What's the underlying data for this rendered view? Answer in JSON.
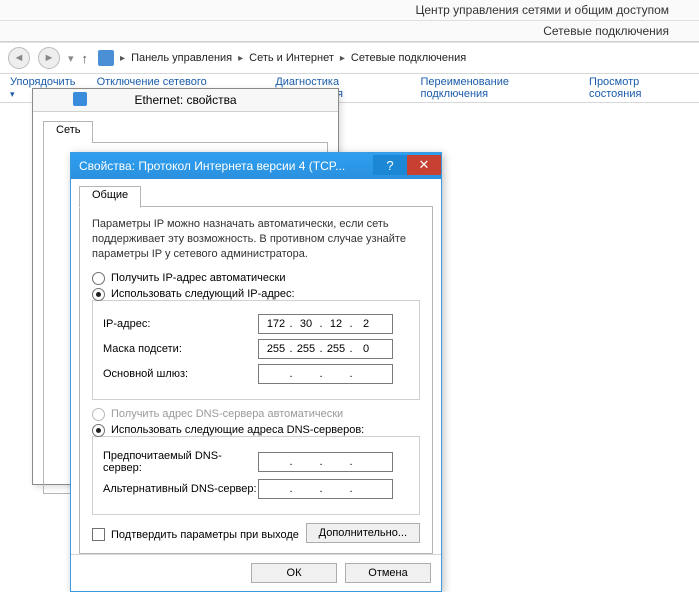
{
  "header": {
    "line1": "Центр управления сетями и общим доступом",
    "line2": "Сетевые подключения"
  },
  "breadcrumb": {
    "items": [
      "Панель управления",
      "Сеть и Интернет",
      "Сетевые подключения"
    ]
  },
  "toolbar": {
    "organize": "Упорядочить",
    "disable": "Отключение сетевого устройства",
    "diagnose": "Диагностика подключения",
    "rename": "Переименование подключения",
    "status": "Просмотр состояния"
  },
  "ethernet": {
    "title": "Ethernet: свойства",
    "tab_net": "Сеть"
  },
  "ipv4": {
    "title": "Свойства: Протокол Интернета версии 4 (TCP...",
    "tab_general": "Общие",
    "desc": "Параметры IP можно назначать автоматически, если сеть поддерживает эту возможность. В противном случае узнайте параметры IP у сетевого администратора.",
    "auto_ip": "Получить IP-адрес автоматически",
    "manual_ip": "Использовать следующий IP-адрес:",
    "ip_label": "IP-адрес:",
    "mask_label": "Маска подсети:",
    "gateway_label": "Основной шлюз:",
    "ip": {
      "o1": "172",
      "o2": "30",
      "o3": "12",
      "o4": "2"
    },
    "mask": {
      "o1": "255",
      "o2": "255",
      "o3": "255",
      "o4": "0"
    },
    "gateway": {
      "o1": "",
      "o2": "",
      "o3": "",
      "o4": ""
    },
    "auto_dns": "Получить адрес DNS-сервера автоматически",
    "manual_dns": "Использовать следующие адреса DNS-серверов:",
    "dns1_label": "Предпочитаемый DNS-сервер:",
    "dns2_label": "Альтернативный DNS-сервер:",
    "dns1": {
      "o1": "",
      "o2": "",
      "o3": "",
      "o4": ""
    },
    "dns2": {
      "o1": "",
      "o2": "",
      "o3": "",
      "o4": ""
    },
    "validate": "Подтвердить параметры при выходе",
    "advanced": "Дополнительно...",
    "ok": "ОК",
    "cancel": "Отмена"
  }
}
